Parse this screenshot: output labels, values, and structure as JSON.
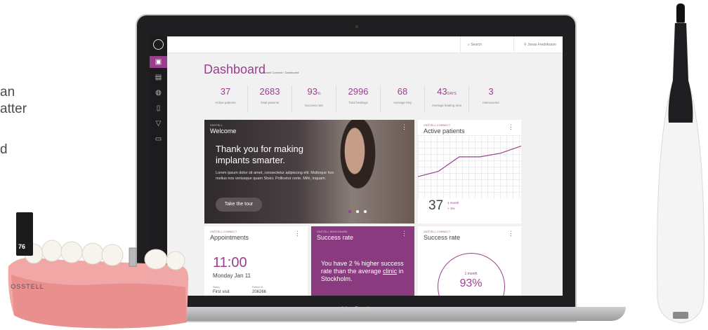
{
  "side_text": [
    "an",
    "atter",
    "d"
  ],
  "laptop": {
    "label": "MacBook"
  },
  "app": {
    "header": {
      "search": "Search",
      "user": "Jonas Fredriksson"
    },
    "title": "Dashboard",
    "breadcrumb": "Osstell Connect › Dashboard",
    "stats": [
      {
        "value": "37",
        "unit": "",
        "label": "Active patients"
      },
      {
        "value": "2683",
        "unit": "",
        "label": "Total patients"
      },
      {
        "value": "93",
        "unit": "%",
        "label": "Success rate"
      },
      {
        "value": "2996",
        "unit": "",
        "label": "Total healings"
      },
      {
        "value": "68",
        "unit": "",
        "label": "Average ISQ"
      },
      {
        "value": "43",
        "unit": "DAYS",
        "label": "Average healing time"
      },
      {
        "value": "3",
        "unit": "",
        "label": "Instruments"
      }
    ],
    "welcome": {
      "kicker": "OSSTELL",
      "title": "Welcome",
      "headline": "Thank you for making implants smarter.",
      "body": "Lorem ipsum dolor sit amet, consectetur adipiscing elit. Multoque hoc melius nos veriusque quam Stoici. Pollicetur certe. Mihi, inquam.",
      "button": "Take the tour"
    },
    "active_patients": {
      "kicker": "OSSTELL CONNECT",
      "title": "Active patients",
      "value": "37",
      "period": "1 month",
      "change": "+ 1%"
    },
    "appointments": {
      "kicker": "OSSTELL CONNECT",
      "title": "Appointments",
      "time": "11:00",
      "date": "Monday Jan 11",
      "status_label": "Status",
      "status_value": "First visit",
      "patient_label": "Patient ID",
      "patient_value": "206266"
    },
    "success_rate_highlight": {
      "kicker": "OSSTELL BENCHMARK",
      "title": "Success rate",
      "text_prefix": "You have 2 % higher success rate than the average ",
      "text_link": "clinic",
      "text_suffix": " in Stockholm."
    },
    "success_rate": {
      "kicker": "OSSTELL CONNECT",
      "title": "Success rate",
      "period": "1 month",
      "value": "93%"
    }
  },
  "device": {
    "brand": "OSSTELL",
    "reading": "76"
  },
  "chart_data": {
    "type": "line",
    "x": [
      0,
      1,
      2,
      3,
      4,
      5
    ],
    "series": [
      {
        "values": [
          24,
          30,
          46,
          46,
          50,
          58
        ]
      }
    ]
  }
}
